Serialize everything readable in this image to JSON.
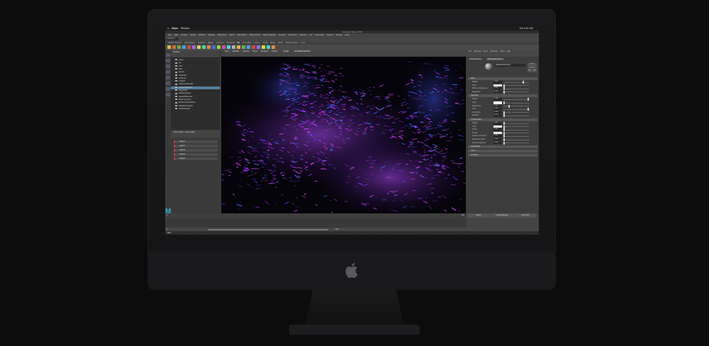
{
  "device": "iMac Pro",
  "app": {
    "menubar": {
      "app_name": "Maya",
      "items": [
        "Window"
      ],
      "clock": "Tue 9:41 AM"
    },
    "window_title": "Autodesk Maya 2018",
    "maya_menu": [
      "File",
      "Edit",
      "Create",
      "Select",
      "Modify",
      "Display",
      "Windows",
      "Mesh",
      "Edit Mesh",
      "Mesh Tools",
      "Mesh Display",
      "Curves",
      "Surfaces",
      "Deform",
      "UV",
      "Generate",
      "Cache",
      "Arnold",
      "Help"
    ],
    "workspace_selector": "Modeling",
    "shelf_tabs": [
      "Curves / Surfaces",
      "Poly Modeling",
      "Sculpting",
      "Rigging",
      "Animation",
      "Rendering",
      "FX",
      "FX Caching",
      "Custom",
      "Arnold",
      "Bifrost",
      "MASH",
      "Motion Graphics",
      "XGen"
    ],
    "outliner": {
      "title": "Outliner",
      "menu": [
        "Display",
        "Show",
        "Help"
      ],
      "items": [
        {
          "label": "persp",
          "selected": false
        },
        {
          "label": "top",
          "selected": false
        },
        {
          "label": "front",
          "selected": false
        },
        {
          "label": "side",
          "selected": false
        },
        {
          "label": "group1",
          "selected": false
        },
        {
          "label": "nParticle1",
          "selected": false
        },
        {
          "label": "nucleus1",
          "selected": false
        },
        {
          "label": "emitter1",
          "selected": false
        },
        {
          "label": "volumeAxisField1",
          "selected": false
        },
        {
          "label": "turbulenceField1",
          "selected": true
        },
        {
          "label": "dragField1",
          "selected": false
        },
        {
          "label": "defaultLightSet",
          "selected": false
        },
        {
          "label": "defaultObjectSet",
          "selected": false
        },
        {
          "label": "MASH1_Repro",
          "selected": false
        },
        {
          "label": "MASH1_ReproMesh",
          "selected": false
        },
        {
          "label": "aiSkyDomeLight1",
          "selected": false
        },
        {
          "label": "ambientLight1",
          "selected": false
        }
      ]
    },
    "layers": {
      "title": "Channel Box / Layer Editor",
      "items": [
        "Layer1",
        "Layer2",
        "Layer3",
        "Layer4",
        "Layer5"
      ]
    },
    "viewport": {
      "panel_menu": [
        "View",
        "Shading",
        "Lighting",
        "Show",
        "Renderer",
        "Panels"
      ],
      "tabs": [
        "Arnold",
        "Arnold RenderView"
      ],
      "render_label": "Arnold RenderView"
    },
    "attribute_editor": {
      "tabs": [
        "List",
        "Selected",
        "Focus",
        "Attributes",
        "Show",
        "Help"
      ],
      "node_tabs": [
        "nParticleShape1",
        "aiStandardSurface1"
      ],
      "node_name": "aiStandardSurface1",
      "buttons": [
        "Focus",
        "Presets",
        "Show",
        "Hide"
      ],
      "sections": [
        {
          "title": "Base",
          "rows": [
            {
              "label": "Weight",
              "value": "0.800"
            },
            {
              "label": "Color",
              "value": ""
            },
            {
              "label": "Diffuse Roughness",
              "value": "0.000"
            },
            {
              "label": "Metalness",
              "value": "0.000"
            }
          ]
        },
        {
          "title": "Specular",
          "rows": [
            {
              "label": "Weight",
              "value": "1.000"
            },
            {
              "label": "Color",
              "value": ""
            },
            {
              "label": "Roughness",
              "value": "0.200"
            },
            {
              "label": "IOR",
              "value": "1.520"
            },
            {
              "label": "Anisotropy",
              "value": "0.000"
            },
            {
              "label": "Rotation",
              "value": "0.000"
            }
          ]
        },
        {
          "title": "Transmission",
          "rows": [
            {
              "label": "Weight",
              "value": "0.000"
            },
            {
              "label": "Color",
              "value": ""
            },
            {
              "label": "Depth",
              "value": "0.000"
            },
            {
              "label": "Scatter",
              "value": ""
            },
            {
              "label": "Scatter Anisotropy",
              "value": "0.000"
            },
            {
              "label": "Dispersion Abbe",
              "value": "0.000"
            },
            {
              "label": "Extra Roughness",
              "value": "0.000"
            }
          ]
        },
        {
          "title": "Subsurface",
          "rows": []
        },
        {
          "title": "Coat",
          "rows": []
        },
        {
          "title": "Emission",
          "rows": []
        }
      ],
      "bottom_buttons": [
        "Select",
        "Load Attributes",
        "Copy Tab"
      ]
    },
    "timeline": {
      "start": "1",
      "end": "120",
      "current": "1"
    },
    "range": {
      "start": "1",
      "end": "200"
    },
    "command_label": "MEL"
  },
  "colors": {
    "selection": "#527ea0",
    "layer_red": "#c23b4a",
    "maya_teal": "#2fb7c9",
    "particles": [
      "#7b2cff",
      "#c13bff",
      "#3b6bff",
      "#e04cff"
    ]
  }
}
